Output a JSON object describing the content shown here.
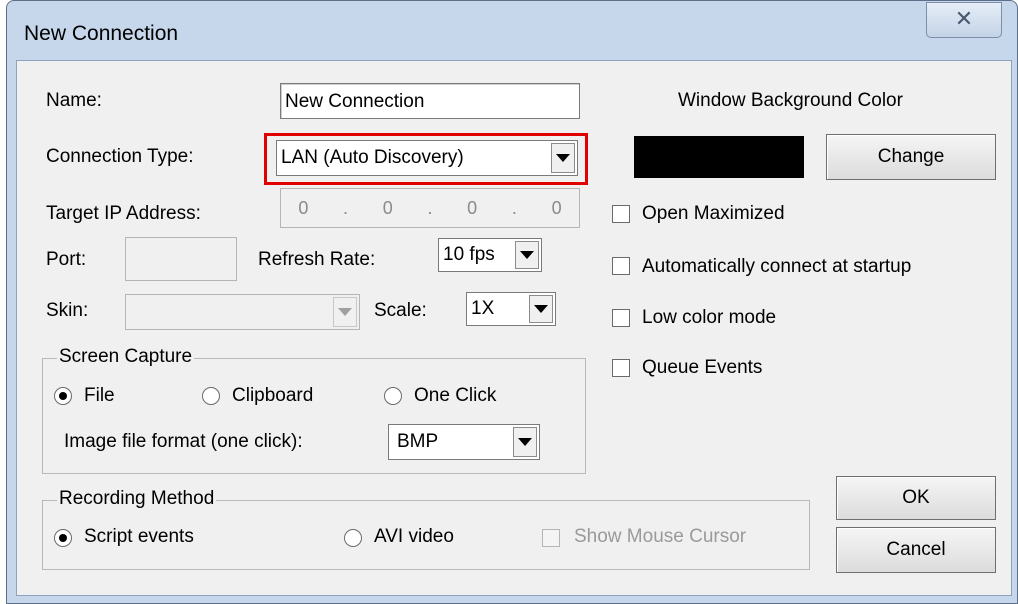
{
  "window": {
    "title": "New Connection",
    "close_glyph": "✕"
  },
  "form": {
    "name_label": "Name:",
    "name_value": "New Connection",
    "connection_type_label": "Connection Type:",
    "connection_type_value": "LAN (Auto Discovery)",
    "target_ip_label": "Target IP Address:",
    "ip_octets": [
      "0",
      "0",
      "0",
      "0"
    ],
    "ip_separator": ".",
    "port_label": "Port:",
    "port_value": "",
    "refresh_rate_label": "Refresh Rate:",
    "refresh_rate_value": "10 fps",
    "skin_label": "Skin:",
    "skin_value": "",
    "scale_label": "Scale:",
    "scale_value": "1X"
  },
  "screen_capture": {
    "title": "Screen Capture",
    "options": [
      "File",
      "Clipboard",
      "One Click"
    ],
    "selected": "File",
    "format_label": "Image file format (one click):",
    "format_value": "BMP"
  },
  "recording": {
    "title": "Recording Method",
    "option_script": "Script events",
    "option_avi": "AVI video",
    "selected": "Script events",
    "show_cursor_label": "Show Mouse Cursor",
    "show_cursor_enabled": false
  },
  "background": {
    "label": "Window Background Color",
    "color": "#000000",
    "change_label": "Change"
  },
  "options": {
    "open_maximized": "Open Maximized",
    "auto_connect": "Automatically connect at startup",
    "low_color": "Low color mode",
    "queue_events": "Queue Events"
  },
  "buttons": {
    "ok": "OK",
    "cancel": "Cancel"
  },
  "colors": {
    "highlight": "#e00000",
    "frame": "#c6d7ec"
  }
}
